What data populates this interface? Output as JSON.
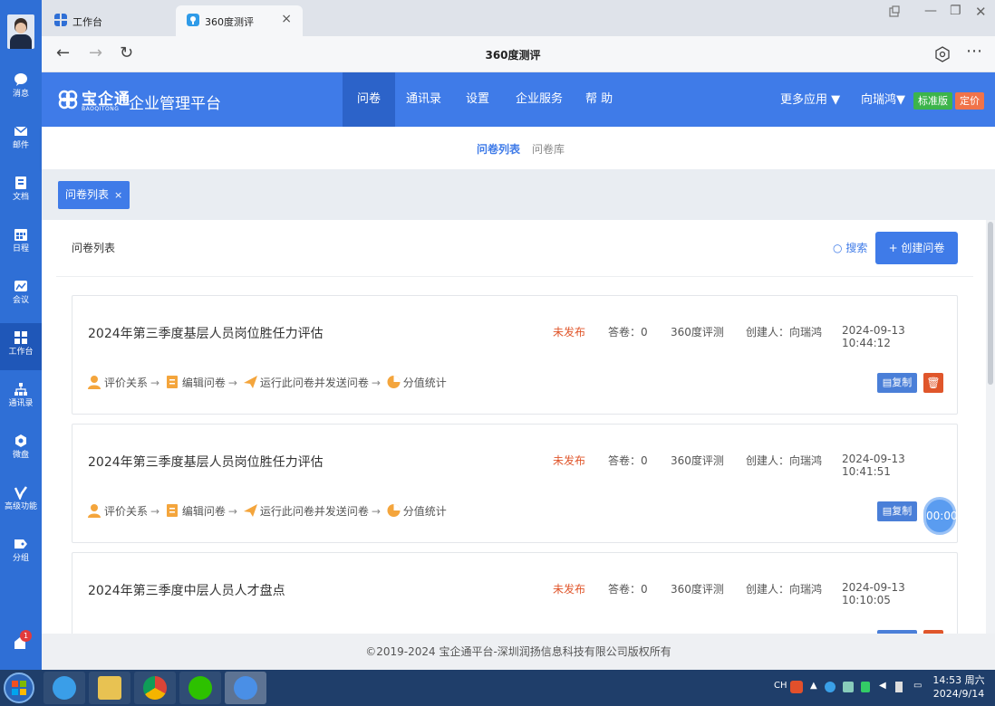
{
  "sidebar": {
    "items": [
      {
        "label": "消息",
        "icon": "message-icon"
      },
      {
        "label": "邮件",
        "icon": "mail-icon"
      },
      {
        "label": "文档",
        "icon": "document-icon"
      },
      {
        "label": "日程",
        "icon": "calendar-icon"
      },
      {
        "label": "会议",
        "icon": "meeting-icon"
      },
      {
        "label": "工作台",
        "icon": "workbench-icon"
      },
      {
        "label": "通讯录",
        "icon": "contacts-icon"
      },
      {
        "label": "微盘",
        "icon": "drive-icon"
      },
      {
        "label": "高级功能",
        "icon": "advanced-icon"
      },
      {
        "label": "分组",
        "icon": "group-icon"
      }
    ],
    "badge_count": "1"
  },
  "browser": {
    "tabs": [
      {
        "label": "工作台"
      },
      {
        "label": "360度测评"
      }
    ],
    "page_title": "360度测评"
  },
  "header": {
    "logo_text": "宝企通",
    "logo_sub": "BAOQITONG",
    "platform_name": "企业管理平台",
    "menu": [
      {
        "label": "问卷"
      },
      {
        "label": "通讯录"
      },
      {
        "label": "设置"
      },
      {
        "label": "企业服务"
      },
      {
        "label": "帮 助"
      }
    ],
    "more_apps": "更多应用",
    "user": "向瑞鸿",
    "edition": "标准版",
    "pricing": "定价"
  },
  "subnav": {
    "items": [
      {
        "label": "问卷列表"
      },
      {
        "label": "问卷库"
      }
    ]
  },
  "tagbar": {
    "chip": "问卷列表"
  },
  "panel": {
    "title": "问卷列表",
    "search_label": "搜索",
    "create_label": "+ 创建问卷",
    "flow_steps": [
      "评价关系",
      "编辑问卷",
      "运行此问卷并发送问卷",
      "分值统计"
    ],
    "copy_label": "复制",
    "cards": [
      {
        "title": "2024年第三季度基层人员岗位胜任力评估",
        "status": "未发布",
        "answers": "答卷：0",
        "type": "360度评测",
        "creator": "创建人：向瑞鸿",
        "datetime": "2024-09-13 10:44:12"
      },
      {
        "title": "2024年第三季度基层人员岗位胜任力评估",
        "status": "未发布",
        "answers": "答卷：0",
        "type": "360度评测",
        "creator": "创建人：向瑞鸿",
        "datetime": "2024-09-13 10:41:51"
      },
      {
        "title": "2024年第三季度中层人员人才盘点",
        "status": "未发布",
        "answers": "答卷：0",
        "type": "360度评测",
        "creator": "创建人：向瑞鸿",
        "datetime": "2024-09-13 10:10:05"
      }
    ]
  },
  "timer": "00:00",
  "footer": "©2019-2024 宝企通平台-深圳润扬信息科技有限公司版权所有",
  "taskbar": {
    "lang": "CH",
    "time": "14:53 周六",
    "date": "2024/9/14"
  }
}
